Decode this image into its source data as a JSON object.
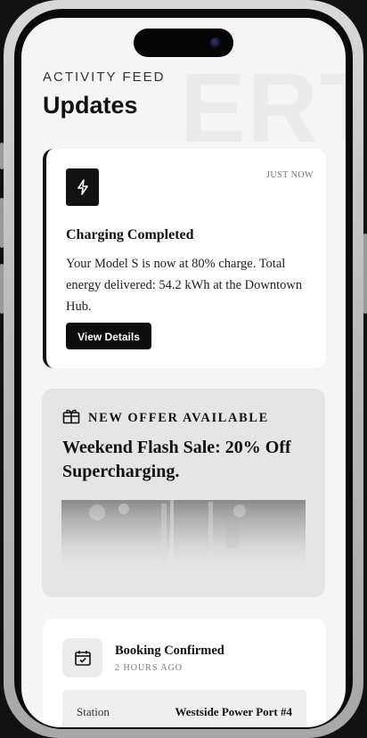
{
  "header": {
    "eyebrow": "ACTIVITY FEED",
    "title": "Updates"
  },
  "feed": {
    "charging": {
      "icon": "lightning-bolt-icon",
      "timestamp": "JUST NOW",
      "title": "Charging Completed",
      "body": "Your Model S is now at 80% charge. Total energy delivered: 54.2 kWh at the Downtown Hub.",
      "button_label": "View Details"
    },
    "offer": {
      "icon": "gift-icon",
      "label": "NEW OFFER AVAILABLE",
      "title": "Weekend Flash Sale: 20% Off Supercharging."
    },
    "booking": {
      "icon": "calendar-check-icon",
      "title": "Booking Confirmed",
      "timestamp": "2 HOURS AGO",
      "detail_label": "Station",
      "detail_value": "Westside Power Port #4"
    }
  },
  "colors": {
    "background": "#f5f5f5",
    "card": "#ffffff",
    "accent": "#111111",
    "offer_card": "#e5e5e5"
  }
}
